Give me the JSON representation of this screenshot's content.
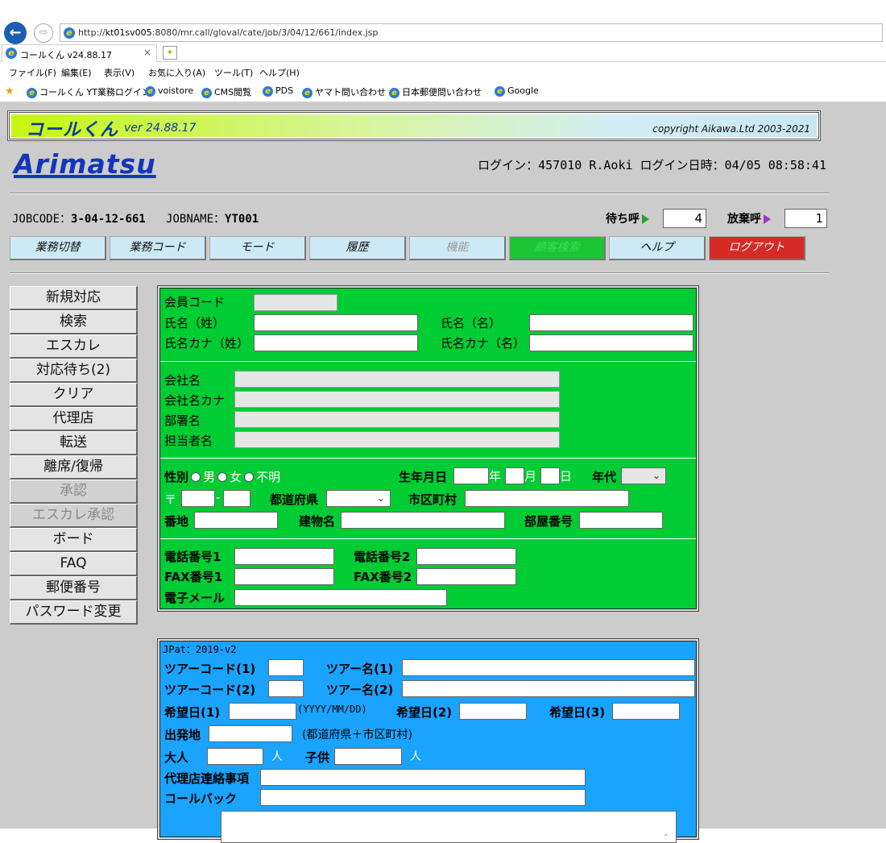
{
  "browser": {
    "url_prefix": "http://",
    "url_host": "kt01sv005",
    "url_rest": ":8080/mr.call/gloval/cate/job/3/04/12/661/index.jsp",
    "tab_title": "コールくん v24.88.17",
    "menu": [
      "ファイル(F)",
      "編集(E)",
      "表示(V)",
      "お気に入り(A)",
      "ツール(T)",
      "ヘルプ(H)"
    ],
    "favorites": [
      "コールくん YT業務ログイン",
      "voistore",
      "CMS閲覧",
      "PDS",
      "ヤマト問い合わせ",
      "日本郵便問い合わせ",
      "Google"
    ]
  },
  "banner": {
    "app_name": "コールくん",
    "version": "ver 24.88.17",
    "copyright": "copyright Aikawa.Ltd 2003-2021"
  },
  "logo": "Arimatsu",
  "login_info": "ログイン：457010 R.Aoki ログイン日時：04/05 08:58:41",
  "job": {
    "code_label": "JOBCODE：",
    "code": "3-04-12-661",
    "name_label": "JOBNAME：",
    "name": "YT001",
    "waiting_label": "待ち呼",
    "waiting_count": "4",
    "abandon_label": "放棄呼",
    "abandon_count": "1"
  },
  "toolbar": [
    "業務切替",
    "業務コード",
    "モード",
    "履歴",
    "機能",
    "顧客検索",
    "ヘルプ",
    "ログアウト"
  ],
  "sidenav": [
    "新規対応",
    "検索",
    "エスカレ",
    "対応待ち(2)",
    "クリア",
    "代理店",
    "転送",
    "離席/復帰",
    "承認",
    "エスカレ承認",
    "ボード",
    "FAQ",
    "郵便番号",
    "パスワード変更"
  ],
  "customer_form": {
    "member_code": "会員コード",
    "last_name": "氏名（姓）",
    "first_name": "氏名（名）",
    "last_kana": "氏名カナ（姓）",
    "first_kana": "氏名カナ（名）",
    "company": "会社名",
    "company_kana": "会社名カナ",
    "department": "部署名",
    "contact": "担当者名",
    "gender": "性別",
    "male": "男",
    "female": "女",
    "unknown": "不明",
    "birthdate": "生年月日",
    "year": "年",
    "month": "月",
    "day": "日",
    "age_group": "年代",
    "postal_mark": "〒",
    "postal_dash": "-",
    "prefecture": "都道府県",
    "city": "市区町村",
    "address": "番地",
    "building": "建物名",
    "room": "部屋番号",
    "phone1": "電話番号1",
    "phone2": "電話番号2",
    "fax1": "FAX番号1",
    "fax2": "FAX番号2",
    "email": "電子メール"
  },
  "tour_form": {
    "header": "JPat：2019-v2",
    "tour_code1": "ツアーコード(1)",
    "tour_name1": "ツアー名(1)",
    "tour_code2": "ツアーコード(2)",
    "tour_name2": "ツアー名(2)",
    "wish_date1": "希望日(1)",
    "date_format": "(YYYY/MM/DD)",
    "wish_date2": "希望日(2)",
    "wish_date3": "希望日(3)",
    "departure": "出発地",
    "departure_note": "(都道府県＋市区町村)",
    "adults": "大人",
    "person_unit": "人",
    "children": "子供",
    "agency_notes": "代理店連絡事項",
    "callback": "コールバック"
  }
}
